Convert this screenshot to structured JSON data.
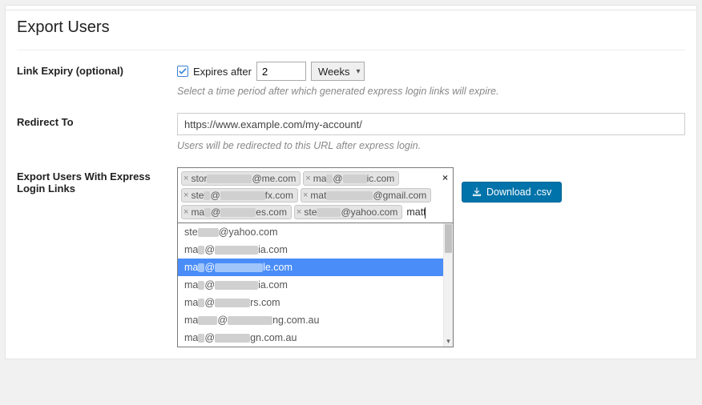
{
  "title": "Export Users",
  "link_expiry": {
    "label": "Link Expiry (optional)",
    "checkbox_label": "Expires after",
    "value": "2",
    "unit": "Weeks",
    "help": "Select a time period after which generated express login links will expire."
  },
  "redirect": {
    "label": "Redirect To",
    "value": "https://www.example.com/my-account/",
    "help": "Users will be redirected to this URL after express login."
  },
  "export": {
    "label": "Export Users With Express Login Links",
    "input_text": "matt",
    "download_label": "Download .csv",
    "tokens": [
      {
        "prefix": "stor",
        "blur_w": 56,
        "suffix": "@me.com"
      },
      {
        "prefix": "ma",
        "blur_w": 8,
        "mid": "@",
        "blur2_w": 30,
        "suffix": "ic.com"
      },
      {
        "prefix": "ste",
        "blur_w": 8,
        "mid": "@",
        "blur2_w": 56,
        "suffix": "fx.com"
      },
      {
        "prefix": "mat",
        "blur_w": 58,
        "suffix": "@gmail.com"
      },
      {
        "prefix": "ma",
        "blur_w": 8,
        "mid": "@",
        "blur2_w": 44,
        "suffix": "es.com"
      },
      {
        "prefix": "ste",
        "blur_w": 30,
        "suffix": "@yahoo.com"
      }
    ],
    "options": [
      {
        "prefix": "ste",
        "blur_w": 26,
        "suffix": "@yahoo.com",
        "highlight": false
      },
      {
        "prefix": "ma",
        "blur_w": 8,
        "mid": "@",
        "blur2_w": 54,
        "suffix": "ia.com",
        "highlight": false
      },
      {
        "prefix": "ma",
        "blur_w": 8,
        "mid": "@",
        "blur2_w": 60,
        "suffix": "le.com",
        "highlight": true
      },
      {
        "prefix": "ma",
        "blur_w": 8,
        "mid": "@",
        "blur2_w": 54,
        "suffix": "ia.com",
        "highlight": false
      },
      {
        "prefix": "ma",
        "blur_w": 8,
        "mid": "@",
        "blur2_w": 44,
        "suffix": "rs.com",
        "highlight": false
      },
      {
        "prefix": "ma",
        "blur_w": 24,
        "mid": "@",
        "blur2_w": 56,
        "suffix": "ng.com.au",
        "highlight": false
      },
      {
        "prefix": "ma",
        "blur_w": 8,
        "mid": "@",
        "blur2_w": 44,
        "suffix": "gn.com.au",
        "highlight": false
      }
    ]
  }
}
